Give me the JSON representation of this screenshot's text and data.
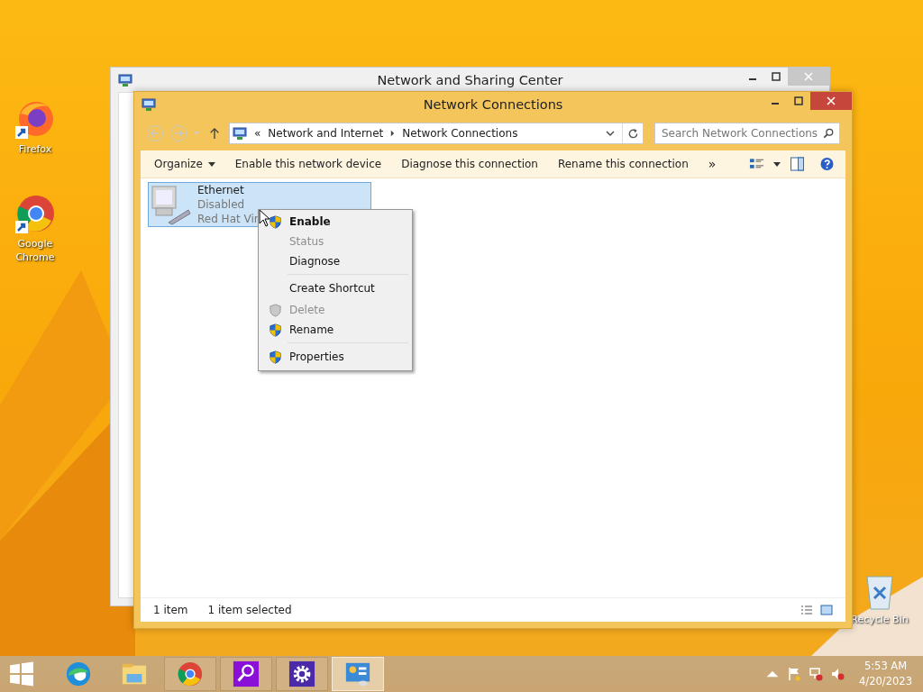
{
  "desktop_icons": [
    {
      "label": "Firefox",
      "kind": "firefox"
    },
    {
      "label": "Google Chrome",
      "kind": "chrome"
    },
    {
      "label": "Recycle Bin",
      "kind": "recycle"
    }
  ],
  "back_window": {
    "title": "Network and Sharing Center"
  },
  "window": {
    "title": "Network Connections",
    "address": {
      "prefix": "«",
      "crumbs": [
        "Network and Internet",
        "Network Connections"
      ]
    },
    "search": {
      "placeholder": "Search Network Connections"
    },
    "toolbar": [
      {
        "label": "Organize",
        "kind": "menu"
      },
      {
        "label": "Enable this network device",
        "kind": "command"
      },
      {
        "label": "Diagnose this connection",
        "kind": "command"
      },
      {
        "label": "Rename this connection",
        "kind": "command"
      },
      {
        "label": "»",
        "kind": "more"
      }
    ],
    "items": [
      {
        "name": "Ethernet",
        "status": "Disabled",
        "device": "Red Hat Vir",
        "selected": true
      }
    ],
    "status_bar": {
      "count": "1 item",
      "selection": "1 item selected"
    }
  },
  "context_menu": [
    {
      "label": "Enable",
      "default": true,
      "disabled": false,
      "shield": true,
      "separator_before": false
    },
    {
      "label": "Status",
      "default": false,
      "disabled": true,
      "shield": false,
      "separator_before": false
    },
    {
      "label": "Diagnose",
      "default": false,
      "disabled": false,
      "shield": false,
      "separator_before": false
    },
    {
      "label": "Create Shortcut",
      "default": false,
      "disabled": false,
      "shield": false,
      "separator_before": true
    },
    {
      "label": "Delete",
      "default": false,
      "disabled": true,
      "shield": true,
      "separator_before": false
    },
    {
      "label": "Rename",
      "default": false,
      "disabled": false,
      "shield": true,
      "separator_before": false
    },
    {
      "label": "Properties",
      "default": false,
      "disabled": false,
      "shield": true,
      "separator_before": true
    }
  ],
  "taskbar": {
    "apps": [
      {
        "kind": "edge",
        "running": false,
        "selected": false
      },
      {
        "kind": "explorer",
        "running": false,
        "selected": false
      },
      {
        "kind": "chrome",
        "running": true,
        "selected": false
      },
      {
        "kind": "search",
        "running": true,
        "selected": false
      },
      {
        "kind": "settings",
        "running": true,
        "selected": false
      },
      {
        "kind": "network",
        "running": true,
        "selected": true
      }
    ],
    "time": "5:53 AM",
    "date": "4/20/2023"
  }
}
